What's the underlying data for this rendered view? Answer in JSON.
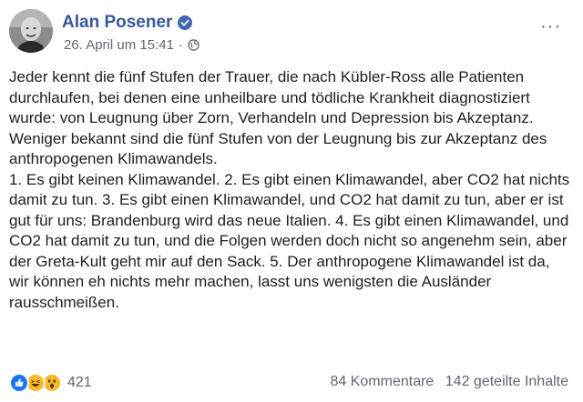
{
  "post": {
    "author": "Alan Posener",
    "timestamp": "26. April um 15:41",
    "meta_separator": "·",
    "privacy_icon": "globe-icon",
    "verified_icon": "verified-badge-icon",
    "more_icon": "more-options-icon",
    "more_label": "···",
    "paragraphs": [
      "Jeder kennt die fünf Stufen der Trauer, die nach Kübler-Ross alle Patienten durchlaufen, bei denen eine unheilbare und tödliche Krankheit diagnostiziert wurde: von Leugnung über Zorn, Verhandeln und Depression bis Akzeptanz.",
      "Weniger bekannt sind die fünf Stufen von der Leugnung bis zur Akzeptanz des anthropogenen Klimawandels.",
      "1. Es gibt keinen Klimawandel. 2. Es gibt einen Klimawandel, aber CO2 hat nichts damit zu tun. 3. Es gibt einen Klimawandel, und CO2 hat damit zu tun, aber er ist gut für uns: Brandenburg wird das neue Italien. 4. Es gibt einen Klimawandel, und CO2 hat damit zu tun, und die Folgen werden doch nicht so angenehm sein, aber der Greta-Kult geht mir auf den Sack. 5. Der anthropogene Klimawandel ist da, wir können eh nichts mehr machen, lasst uns wenigsten die Ausländer rausschmeißen."
    ]
  },
  "footer": {
    "reactions": [
      "like-icon",
      "haha-icon",
      "wow-icon"
    ],
    "reaction_count": "421",
    "comments": "84 Kommentare",
    "shares": "142 geteilte Inhalte"
  },
  "colors": {
    "name": "#365899",
    "meta": "#616770",
    "text": "#1c1e21",
    "like": "#1877f2",
    "haha": "#f7b928"
  }
}
